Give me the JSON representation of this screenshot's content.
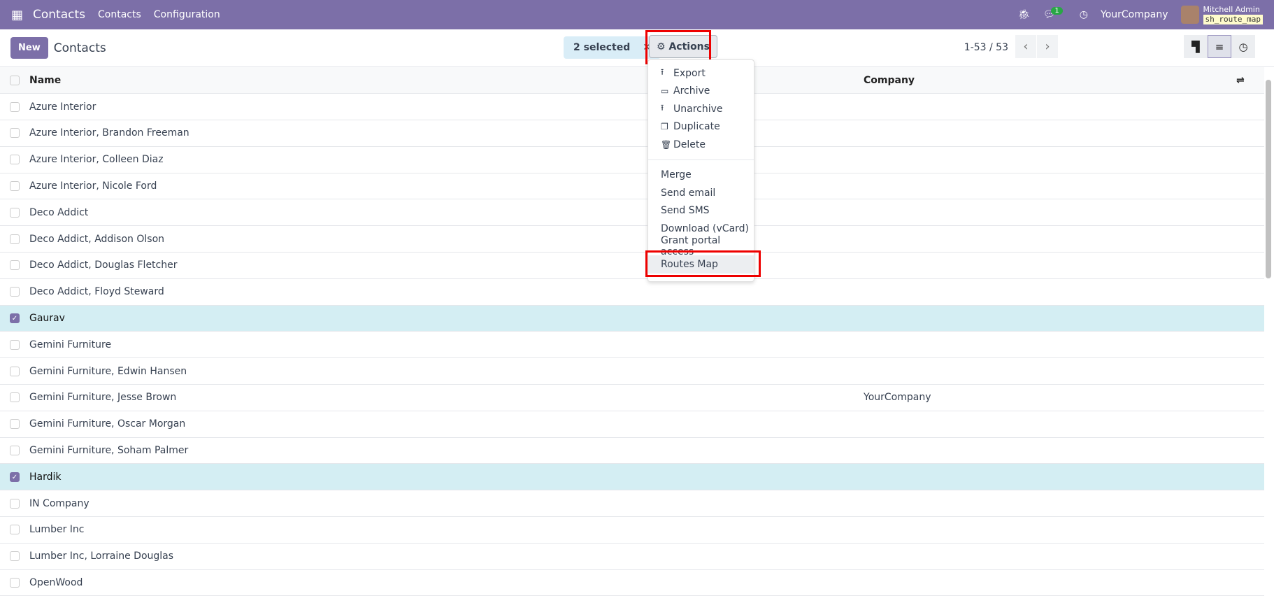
{
  "navbar": {
    "app": "Contacts",
    "menus": [
      "Contacts",
      "Configuration"
    ],
    "chat_count": "1",
    "company": "YourCompany",
    "user": "Mitchell Admin",
    "db": "sh_route_map"
  },
  "control": {
    "new_label": "New",
    "title": "Contacts",
    "selected": "2 selected",
    "actions_label": "Actions",
    "pager": "1-53 / 53"
  },
  "table": {
    "headers": [
      "Name",
      "Company"
    ],
    "rows": [
      {
        "name": "Azure Interior",
        "company": "",
        "checked": false
      },
      {
        "name": "Azure Interior, Brandon Freeman",
        "company": "",
        "checked": false
      },
      {
        "name": "Azure Interior, Colleen Diaz",
        "company": "",
        "checked": false
      },
      {
        "name": "Azure Interior, Nicole Ford",
        "company": "",
        "checked": false
      },
      {
        "name": "Deco Addict",
        "company": "",
        "checked": false
      },
      {
        "name": "Deco Addict, Addison Olson",
        "company": "",
        "checked": false
      },
      {
        "name": "Deco Addict, Douglas Fletcher",
        "company": "",
        "checked": false
      },
      {
        "name": "Deco Addict, Floyd Steward",
        "company": "",
        "checked": false
      },
      {
        "name": "Gaurav",
        "company": "",
        "checked": true
      },
      {
        "name": "Gemini Furniture",
        "company": "",
        "checked": false
      },
      {
        "name": "Gemini Furniture, Edwin Hansen",
        "company": "",
        "checked": false
      },
      {
        "name": "Gemini Furniture, Jesse Brown",
        "company": "YourCompany",
        "checked": false
      },
      {
        "name": "Gemini Furniture, Oscar Morgan",
        "company": "",
        "checked": false
      },
      {
        "name": "Gemini Furniture, Soham Palmer",
        "company": "",
        "checked": false
      },
      {
        "name": "Hardik",
        "company": "",
        "checked": true
      },
      {
        "name": "IN Company",
        "company": "",
        "checked": false
      },
      {
        "name": "Lumber Inc",
        "company": "",
        "checked": false
      },
      {
        "name": "Lumber Inc, Lorraine Douglas",
        "company": "",
        "checked": false
      },
      {
        "name": "OpenWood",
        "company": "",
        "checked": false
      }
    ]
  },
  "actions_menu": {
    "primary": [
      {
        "label": "Export",
        "icon": "upload-icon"
      },
      {
        "label": "Archive",
        "icon": "inbox-icon"
      },
      {
        "label": "Unarchive",
        "icon": "unarchive-icon"
      },
      {
        "label": "Duplicate",
        "icon": "copy-icon"
      },
      {
        "label": "Delete",
        "icon": "trash-icon"
      }
    ],
    "secondary": [
      "Merge",
      "Send email",
      "Send SMS",
      "Download (vCard)",
      "Grant portal access",
      "Routes Map"
    ]
  }
}
